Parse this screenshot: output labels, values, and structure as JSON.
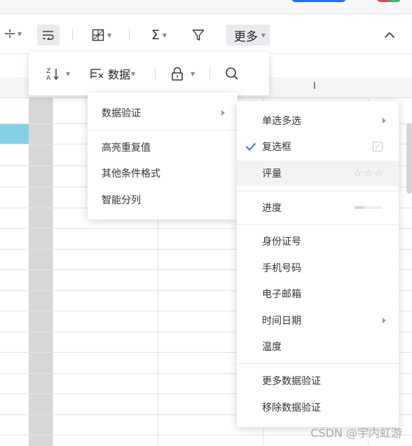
{
  "toolbar": {
    "more_label": "更多"
  },
  "column_header": {
    "visible_letter": "I"
  },
  "data_popup": {
    "data_label": "数据"
  },
  "left_menu": {
    "items": [
      {
        "label": "数据验证",
        "has_submenu": true
      },
      {
        "label": "高亮重复值"
      },
      {
        "label": "其他条件格式"
      },
      {
        "label": "智能分列"
      }
    ]
  },
  "right_menu": {
    "items": [
      {
        "label": "单选多选",
        "has_submenu": true
      },
      {
        "label": "复选框",
        "checked": true
      },
      {
        "label": "评量",
        "hovered": true
      },
      {
        "label": "进度",
        "progress": 0.35
      },
      {
        "label": "身份证号"
      },
      {
        "label": "手机号码"
      },
      {
        "label": "电子邮箱"
      },
      {
        "label": "时间日期",
        "has_submenu": true
      },
      {
        "label": "温度"
      },
      {
        "label": "更多数据验证"
      },
      {
        "label": "移除数据验证"
      }
    ]
  },
  "watermark": "CSDN @宇内虹游",
  "colors": {
    "accent": "#1e6fff",
    "selected_cell": "#83d0e5",
    "checkmark": "#1e6fff"
  }
}
